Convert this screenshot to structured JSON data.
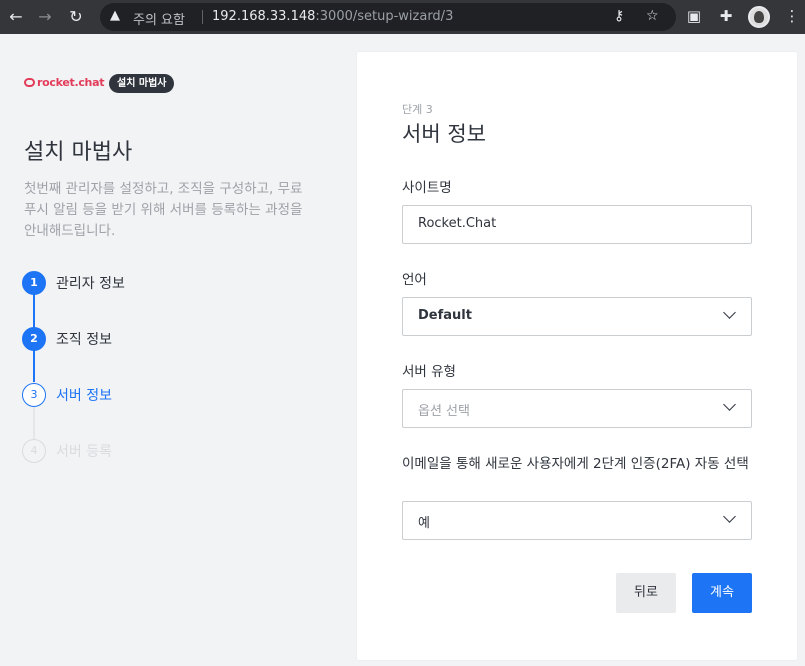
{
  "browser": {
    "security_warning": "주의 요함",
    "url_host": "192.168.33.148",
    "url_path": ":3000/setup-wizard/3"
  },
  "sidebar": {
    "brand_name": "rocket.chat",
    "brand_tag": "설치 마법사",
    "title": "설치 마법사",
    "description": "첫번째 관리자를 설정하고, 조직을 구성하고, 무료 푸시 알림 등을 받기 위해 서버를 등록하는 과정을 안내해드립니다.",
    "steps": [
      {
        "number": "1",
        "label": "관리자 정보",
        "state": "done"
      },
      {
        "number": "2",
        "label": "조직 정보",
        "state": "done"
      },
      {
        "number": "3",
        "label": "서버 정보",
        "state": "current"
      },
      {
        "number": "4",
        "label": "서버 등록",
        "state": "todo"
      }
    ]
  },
  "form": {
    "step_label": "단계 3",
    "title": "서버 정보",
    "site_name": {
      "label": "사이트명",
      "value": "Rocket.Chat"
    },
    "language": {
      "label": "언어",
      "value": "Default"
    },
    "server_type": {
      "label": "서버 유형",
      "placeholder": "옵션 선택"
    },
    "two_factor": {
      "label": "이메일을 통해 새로운 사용자에게 2단계 인증(2FA) 자동 선택",
      "value": "예"
    },
    "back_label": "뒤로",
    "next_label": "계속"
  },
  "colors": {
    "accent": "#1d74f5",
    "brand": "#e33c5b"
  }
}
